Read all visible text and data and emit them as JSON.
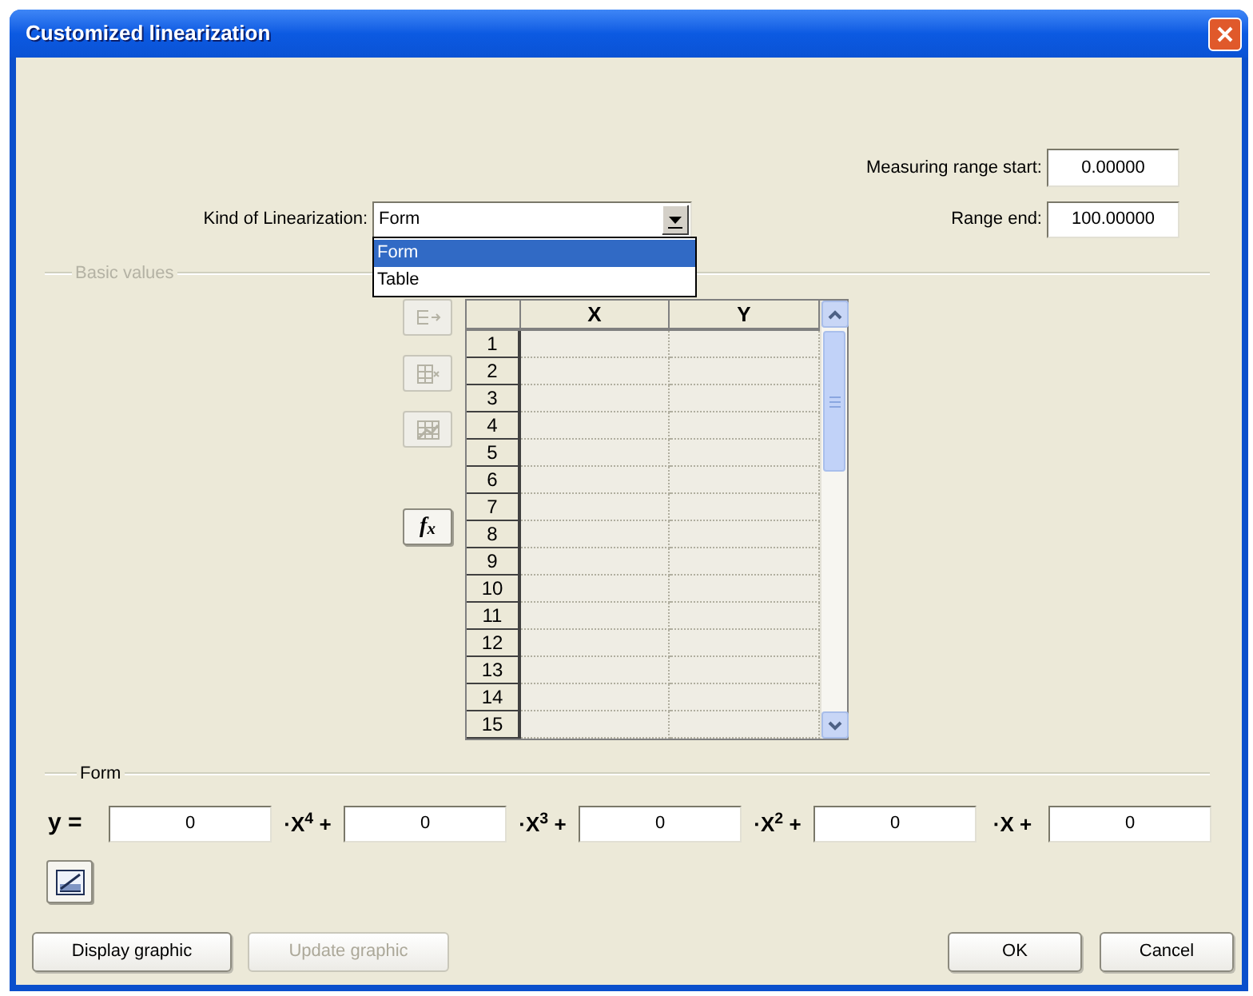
{
  "window": {
    "title": "Customized linearization"
  },
  "measuring_range": {
    "start": {
      "label": "Measuring range start:",
      "value": "0.00000"
    },
    "end": {
      "label": "Range end:",
      "value": "100.00000"
    }
  },
  "kind_of_linearization": {
    "label": "Kind of Linearization:",
    "value": "Form",
    "expanded": true,
    "options": [
      {
        "label": "Form",
        "selected": true
      },
      {
        "label": "Table",
        "selected": false
      }
    ]
  },
  "basic_values": {
    "title": "Basic values",
    "disabled": true,
    "tools": [
      {
        "kind": "insert_rows",
        "disabled": true
      },
      {
        "kind": "delete_rows",
        "disabled": true
      },
      {
        "kind": "chart",
        "disabled": true
      },
      {
        "kind": "formula",
        "label": "f$_{x}$",
        "disabled": false
      }
    ],
    "table": {
      "columns": [
        "X",
        "Y"
      ],
      "rows": [
        "1",
        "2",
        "3",
        "4",
        "5",
        "6",
        "7",
        "8",
        "9",
        "10",
        "11",
        "12",
        "13",
        "14",
        "15"
      ]
    }
  },
  "form": {
    "title": "Form",
    "lhs": "y =",
    "terms": [
      {
        "value": "0",
        "suffix": "·X$^{4}$ +"
      },
      {
        "value": "0",
        "suffix": "·X$^{3}$ +"
      },
      {
        "value": "0",
        "suffix": "·X$^{2}$ +"
      },
      {
        "value": "0",
        "suffix": "·X +"
      },
      {
        "value": "0"
      }
    ],
    "tools": [
      {
        "kind": "graph",
        "disabled": false
      }
    ]
  },
  "buttons": [
    {
      "label": "Display graphic",
      "disabled": false
    },
    {
      "label": "Update graphic",
      "disabled": true
    },
    {
      "label": "OK",
      "disabled": false
    },
    {
      "label": "Cancel",
      "disabled": false
    }
  ]
}
